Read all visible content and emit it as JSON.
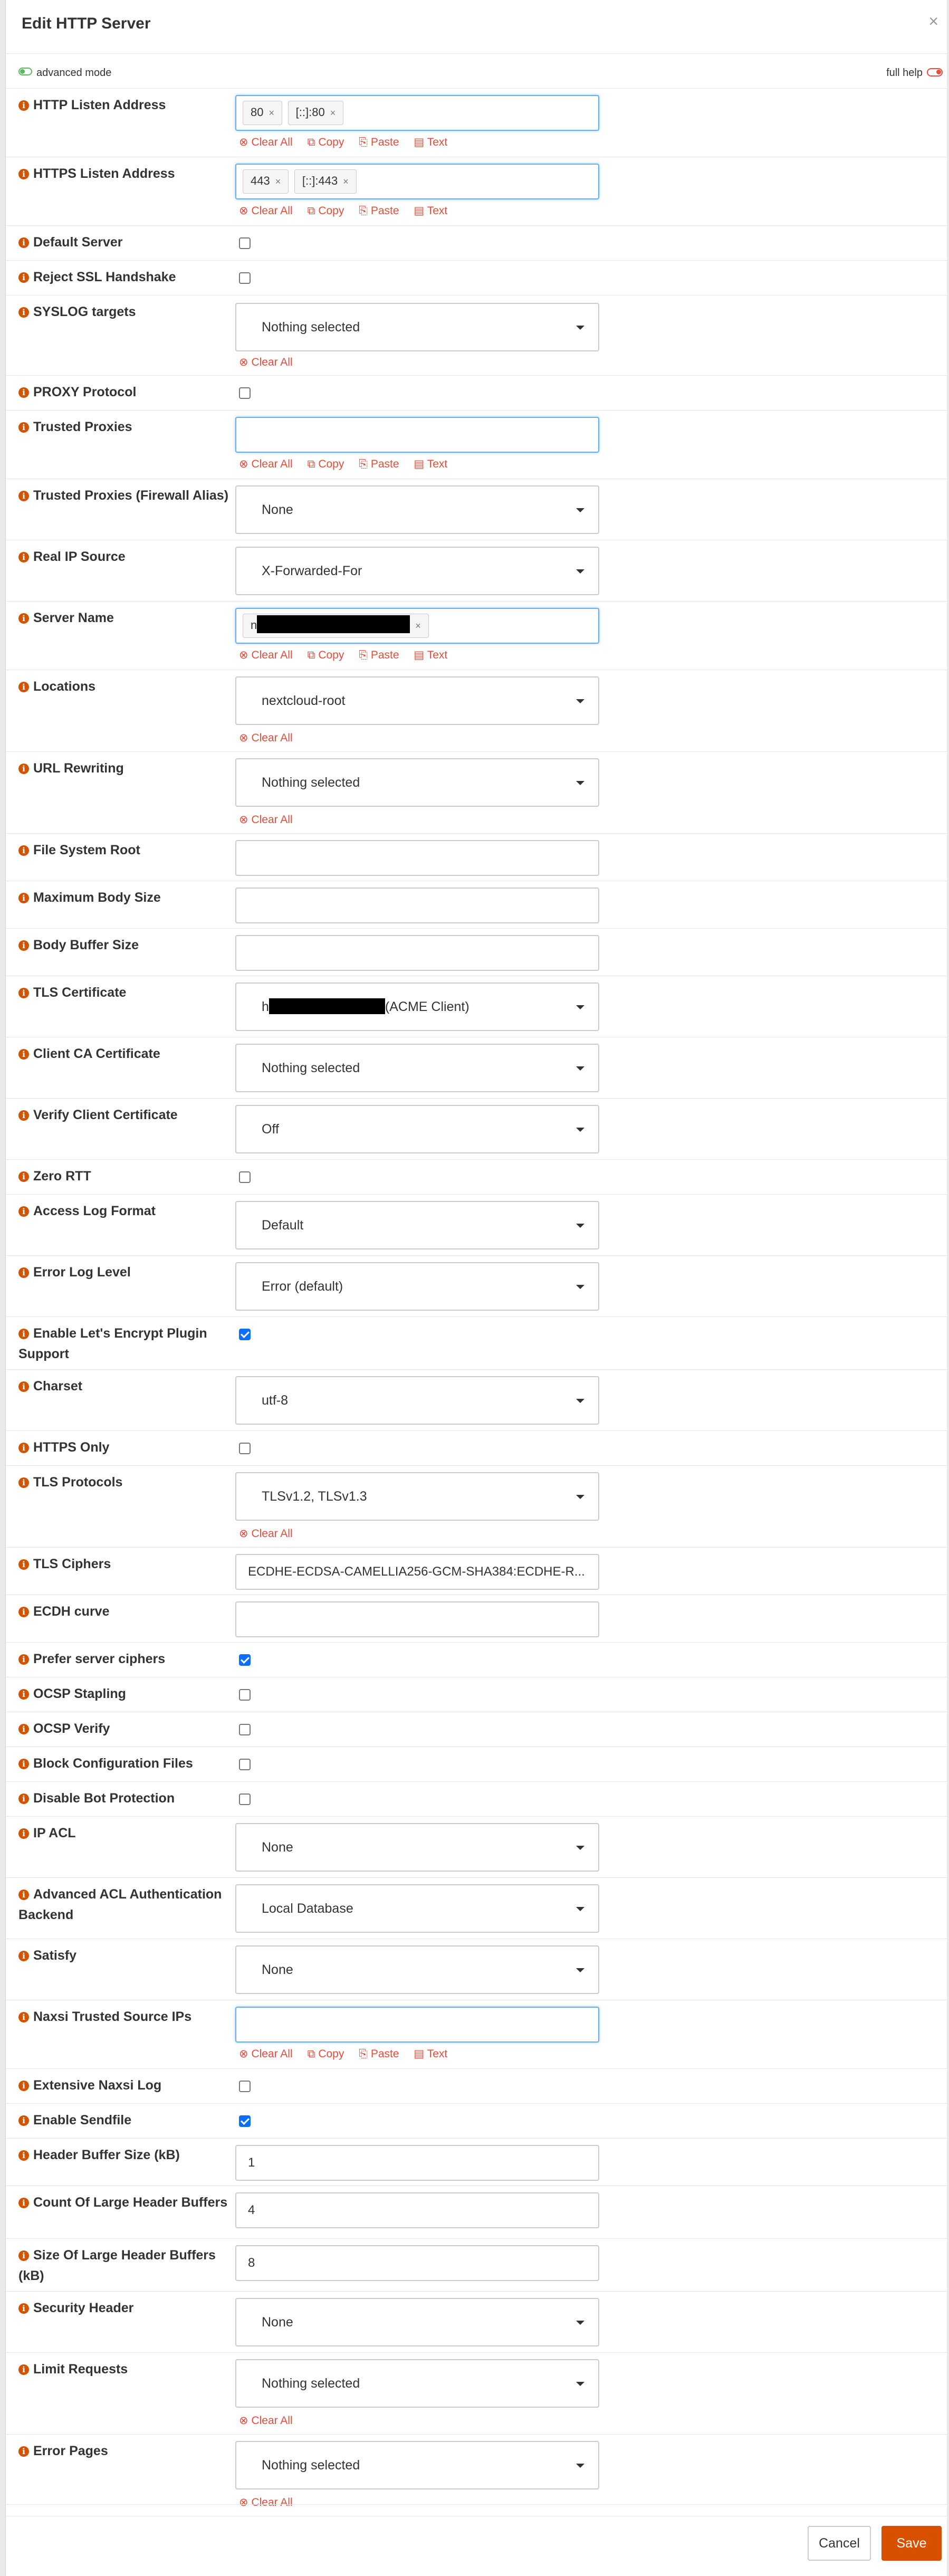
{
  "modal": {
    "title": "Edit HTTP Server",
    "close_icon": "×",
    "advanced_mode_label": "advanced mode",
    "full_help_label": "full help"
  },
  "actions": {
    "clear_all": "Clear All",
    "copy": "Copy",
    "paste": "Paste",
    "text": "Text"
  },
  "fields": {
    "http_listen": {
      "label": "HTTP Listen Address",
      "tokens": [
        "80",
        "[::]:80"
      ]
    },
    "https_listen": {
      "label": "HTTPS Listen Address",
      "tokens": [
        "443",
        "[::]:443"
      ]
    },
    "default_server": {
      "label": "Default Server",
      "checked": false
    },
    "reject_ssl": {
      "label": "Reject SSL Handshake",
      "checked": false
    },
    "syslog": {
      "label": "SYSLOG targets",
      "value": "Nothing selected"
    },
    "proxy_protocol": {
      "label": "PROXY Protocol",
      "checked": false
    },
    "trusted_proxies": {
      "label": "Trusted Proxies",
      "value": ""
    },
    "trusted_proxies_alias": {
      "label": "Trusted Proxies (Firewall Alias)",
      "value": "None"
    },
    "real_ip_source": {
      "label": "Real IP Source",
      "value": "X-Forwarded-For"
    },
    "server_name": {
      "label": "Server Name",
      "token_prefix": "n"
    },
    "locations": {
      "label": "Locations",
      "value": "nextcloud-root"
    },
    "url_rewriting": {
      "label": "URL Rewriting",
      "value": "Nothing selected"
    },
    "fs_root": {
      "label": "File System Root",
      "value": ""
    },
    "max_body": {
      "label": "Maximum Body Size",
      "value": ""
    },
    "body_buffer": {
      "label": "Body Buffer Size",
      "value": ""
    },
    "tls_cert": {
      "label": "TLS Certificate",
      "prefix": "h",
      "suffix": "(ACME Client)"
    },
    "client_ca": {
      "label": "Client CA Certificate",
      "value": "Nothing selected"
    },
    "verify_client": {
      "label": "Verify Client Certificate",
      "value": "Off"
    },
    "zero_rtt": {
      "label": "Zero RTT",
      "checked": false
    },
    "access_log": {
      "label": "Access Log Format",
      "value": "Default"
    },
    "error_log": {
      "label": "Error Log Level",
      "value": "Error (default)"
    },
    "letsencrypt": {
      "label": "Enable Let's Encrypt Plugin Support",
      "checked": true
    },
    "charset": {
      "label": "Charset",
      "value": "utf-8"
    },
    "https_only": {
      "label": "HTTPS Only",
      "checked": false
    },
    "tls_protocols": {
      "label": "TLS Protocols",
      "value": "TLSv1.2, TLSv1.3"
    },
    "tls_ciphers": {
      "label": "TLS Ciphers",
      "value": "ECDHE-ECDSA-CAMELLIA256-GCM-SHA384:ECDHE-R..."
    },
    "ecdh_curve": {
      "label": "ECDH curve",
      "value": ""
    },
    "prefer_server_ciphers": {
      "label": "Prefer server ciphers",
      "checked": true
    },
    "ocsp_stapling": {
      "label": "OCSP Stapling",
      "checked": false
    },
    "ocsp_verify": {
      "label": "OCSP Verify",
      "checked": false
    },
    "block_config": {
      "label": "Block Configuration Files",
      "checked": false
    },
    "disable_bot": {
      "label": "Disable Bot Protection",
      "checked": false
    },
    "ip_acl": {
      "label": "IP ACL",
      "value": "None"
    },
    "adv_acl": {
      "label": "Advanced ACL Authentication Backend",
      "value": "Local Database"
    },
    "satisfy": {
      "label": "Satisfy",
      "value": "None"
    },
    "naxsi_ips": {
      "label": "Naxsi Trusted Source IPs",
      "value": ""
    },
    "naxsi_log": {
      "label": "Extensive Naxsi Log",
      "checked": false
    },
    "sendfile": {
      "label": "Enable Sendfile",
      "checked": true
    },
    "header_buffer": {
      "label": "Header Buffer Size (kB)",
      "value": "1"
    },
    "large_header_count": {
      "label": "Count Of Large Header Buffers",
      "value": "4"
    },
    "large_header_size": {
      "label": "Size Of Large Header Buffers (kB)",
      "value": "8"
    },
    "security_header": {
      "label": "Security Header",
      "value": "None"
    },
    "limit_requests": {
      "label": "Limit Requests",
      "value": "Nothing selected"
    },
    "error_pages": {
      "label": "Error Pages",
      "value": "Nothing selected"
    }
  },
  "footer": {
    "cancel_label": "Cancel",
    "save_label": "Save"
  }
}
